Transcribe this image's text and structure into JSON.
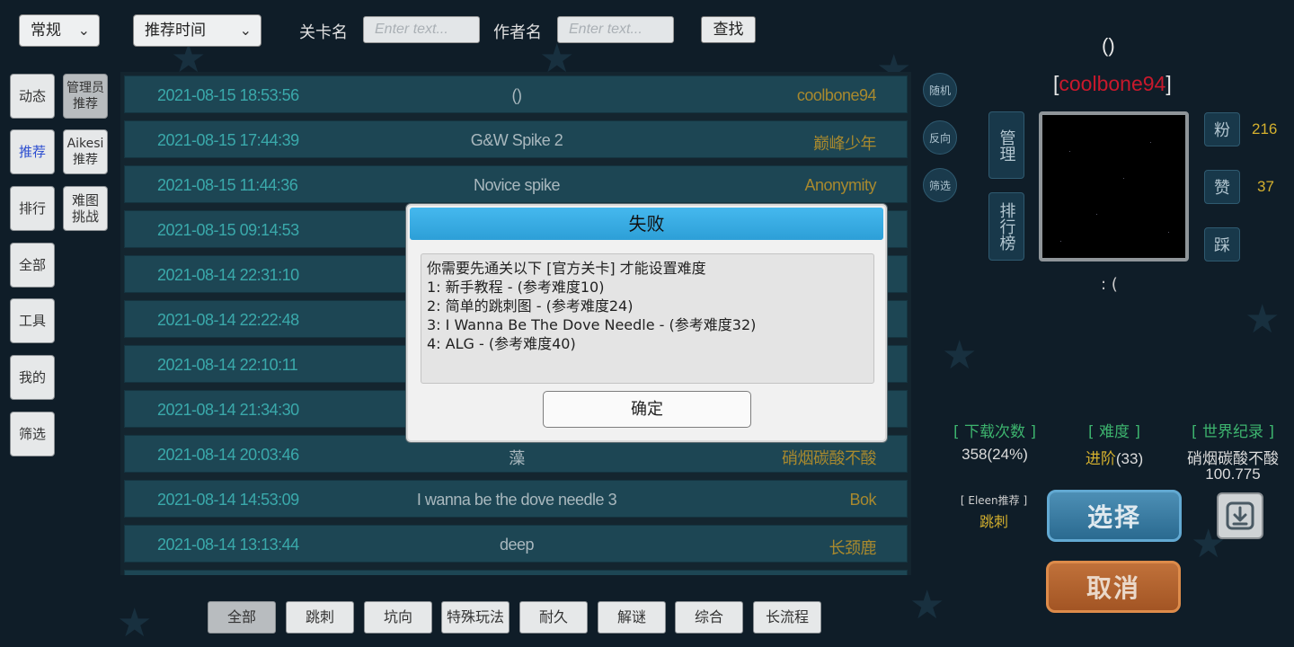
{
  "top_bar": {
    "mode_select": "常规",
    "sort_select": "推荐时间",
    "level_name_label": "关卡名",
    "level_name_placeholder": "Enter text...",
    "author_label": "作者名",
    "author_placeholder": "Enter text...",
    "search_label": "查找"
  },
  "left_nav": {
    "dynamic": "动态",
    "admin_recommend": "管理员\n推荐",
    "recommend": "推荐",
    "aikesi_recommend": "Aikesi\n推荐",
    "ranking": "排行",
    "hard_challenge": "难图\n挑战",
    "all": "全部",
    "tools": "工具",
    "mine": "我的",
    "filter": "筛选"
  },
  "levels": [
    {
      "date": "2021-08-15 18:53:56",
      "title": "()",
      "author": "coolbone94"
    },
    {
      "date": "2021-08-15 17:44:39",
      "title": "G&W Spike 2",
      "author": "巅峰少年"
    },
    {
      "date": "2021-08-15 11:44:36",
      "title": "Novice spike",
      "author": "Anonymity"
    },
    {
      "date": "2021-08-15 09:14:53",
      "title": "",
      "author": ""
    },
    {
      "date": "2021-08-14 22:31:10",
      "title": "",
      "author": ""
    },
    {
      "date": "2021-08-14 22:22:48",
      "title": "",
      "author": ""
    },
    {
      "date": "2021-08-14 22:10:11",
      "title": "",
      "author": ""
    },
    {
      "date": "2021-08-14 21:34:30",
      "title": "",
      "author": ""
    },
    {
      "date": "2021-08-14 20:03:46",
      "title": "藻",
      "author": "硝烟碳酸不酸"
    },
    {
      "date": "2021-08-14 14:53:09",
      "title": "I wanna be the dove needle 3",
      "author": "Bok"
    },
    {
      "date": "2021-08-14 13:13:44",
      "title": "deep",
      "author": "长颈鹿"
    }
  ],
  "side_buttons": {
    "random": "随机",
    "reverse": "反向",
    "filter": "筛选"
  },
  "detail": {
    "title": "()",
    "author_open": "[",
    "author": "coolbone94",
    "author_close": "]",
    "manage": "管理",
    "leaderboard": "排行榜",
    "fans_label": "粉",
    "fans_count": "216",
    "likes_label": "赞",
    "likes_count": "37",
    "dislike_label": "踩",
    "description": ":  (",
    "downloads_header": "[ 下载次数 ]",
    "downloads_value": "358(24%)",
    "difficulty_header": "[ 难度 ]",
    "difficulty_level": "进阶",
    "difficulty_value": "(33)",
    "record_header": "[ 世界纪录 ]",
    "record_holder": "硝烟碳酸不酸",
    "record_time": "100.775",
    "recommender": "[ Eleen推荐 ]",
    "category": "跳刺",
    "select_button": "选择",
    "cancel_button": "取消"
  },
  "bottom_tabs": [
    "全部",
    "跳刺",
    "坑向",
    "特殊玩法",
    "耐久",
    "解谜",
    "综合",
    "长流程"
  ],
  "modal": {
    "title": "失败",
    "lines": [
      "你需要先通关以下 [官方关卡] 才能设置难度",
      "1:  新手教程 - (参考难度10)",
      "2:  简单的跳刺图 - (参考难度24)",
      "3:  I Wanna Be The Dove Needle - (参考难度32)",
      "4:  ALG - (参考难度40)"
    ],
    "ok_button": "确定"
  },
  "colors": {
    "background": "#0f1d28",
    "row": "#1d4654",
    "date_text": "#3aa9ab",
    "author_text": "#a8892e",
    "username": "#c8192c",
    "header_green": "#3db46e",
    "gold": "#d4b02e",
    "modal_header": "#2d9fd7"
  }
}
